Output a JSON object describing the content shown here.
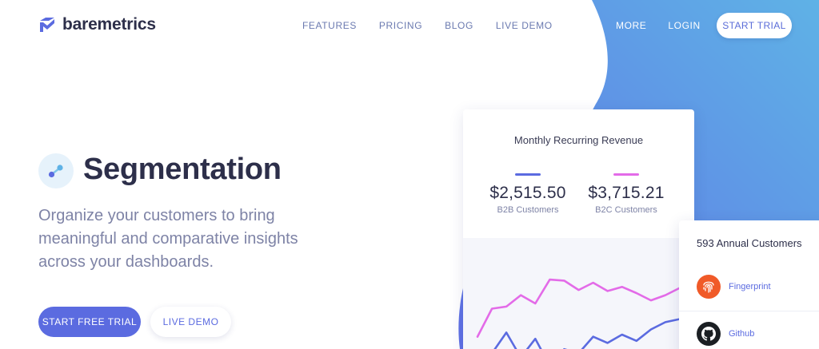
{
  "brand": {
    "name": "baremetrics"
  },
  "nav": {
    "features": "FEATURES",
    "pricing": "PRICING",
    "blog": "BLOG",
    "live_demo": "LIVE DEMO",
    "more": "MORE",
    "login": "LOGIN",
    "start_trial": "START TRIAL"
  },
  "hero": {
    "icon": "segment-icon",
    "title": "Segmentation",
    "subtitle": "Organize your customers to bring meaningful and comparative insights across your dashboards.",
    "primary_cta": "START FREE TRIAL",
    "secondary_cta": "LIVE DEMO"
  },
  "mrr_card": {
    "title": "Monthly Recurring Revenue",
    "b2b": {
      "value": "$2,515.50",
      "label": "B2B Customers",
      "color": "#5b6be0"
    },
    "b2c": {
      "value": "$3,715.21",
      "label": "B2C Customers",
      "color": "#e36be8"
    }
  },
  "chart_data": {
    "type": "line",
    "series": [
      {
        "values": [
          28,
          55,
          57,
          68,
          60,
          83,
          82,
          73,
          80,
          72,
          76,
          70,
          63,
          68,
          75
        ]
      },
      {
        "values": [
          5,
          12,
          32,
          8,
          26,
          0,
          16,
          12,
          28,
          22,
          30,
          24,
          35,
          42,
          45
        ]
      }
    ],
    "colors": [
      "#e36be8",
      "#5b6be0"
    ],
    "ylim": [
      0,
      100
    ]
  },
  "customers_card": {
    "title": "593 Annual Customers",
    "items": [
      {
        "name": "Fingerprint",
        "icon": "fingerprint-icon",
        "color": "#f05a28"
      },
      {
        "name": "Github",
        "icon": "github-icon",
        "color": "#1b1f23"
      }
    ]
  },
  "colors": {
    "accent": "#5b6be0",
    "gradient_start": "#5f73e6",
    "gradient_end": "#5eaee6"
  }
}
